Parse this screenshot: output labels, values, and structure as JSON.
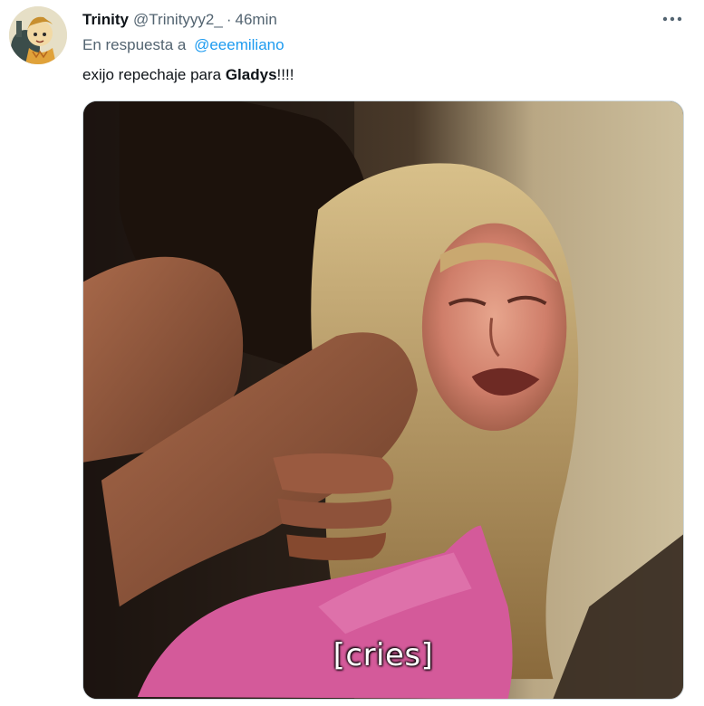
{
  "tweet": {
    "display_name": "Trinity",
    "handle": "@Trinityyy2_",
    "separator": "·",
    "time": "46min",
    "reply_prefix": "En respuesta a",
    "reply_mention": "@eeemiliano",
    "text_before": "exijo repechaje para ",
    "text_bold": "Gladys",
    "text_after": "!!!!",
    "media_caption": "[cries]",
    "more_icon": "more-horizontal-icon"
  },
  "colors": {
    "text_primary": "#0f1419",
    "text_secondary": "#536471",
    "link": "#1d9bf0",
    "border": "#cfd9de"
  }
}
